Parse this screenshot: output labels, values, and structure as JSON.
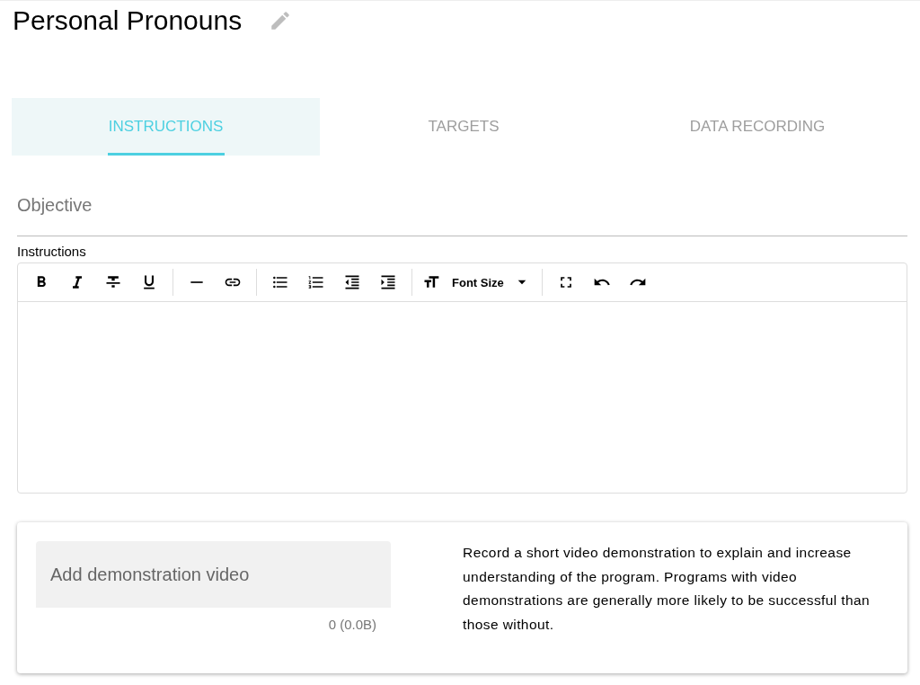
{
  "title": "Personal Pronouns",
  "tabs": [
    {
      "label": "INSTRUCTIONS",
      "selected": true
    },
    {
      "label": "TARGETS",
      "selected": false
    },
    {
      "label": "DATA RECORDING",
      "selected": false
    }
  ],
  "objective": {
    "placeholder": "Objective"
  },
  "instructions": {
    "label": "Instructions",
    "font_size_label": "Font Size"
  },
  "video": {
    "placeholder": "Add demonstration video",
    "counter": "0 (0.0B)",
    "description": "Record a short video demonstration to explain and increase understanding of the program. Programs with video demonstrations are generally more likely to be successful than those without."
  }
}
